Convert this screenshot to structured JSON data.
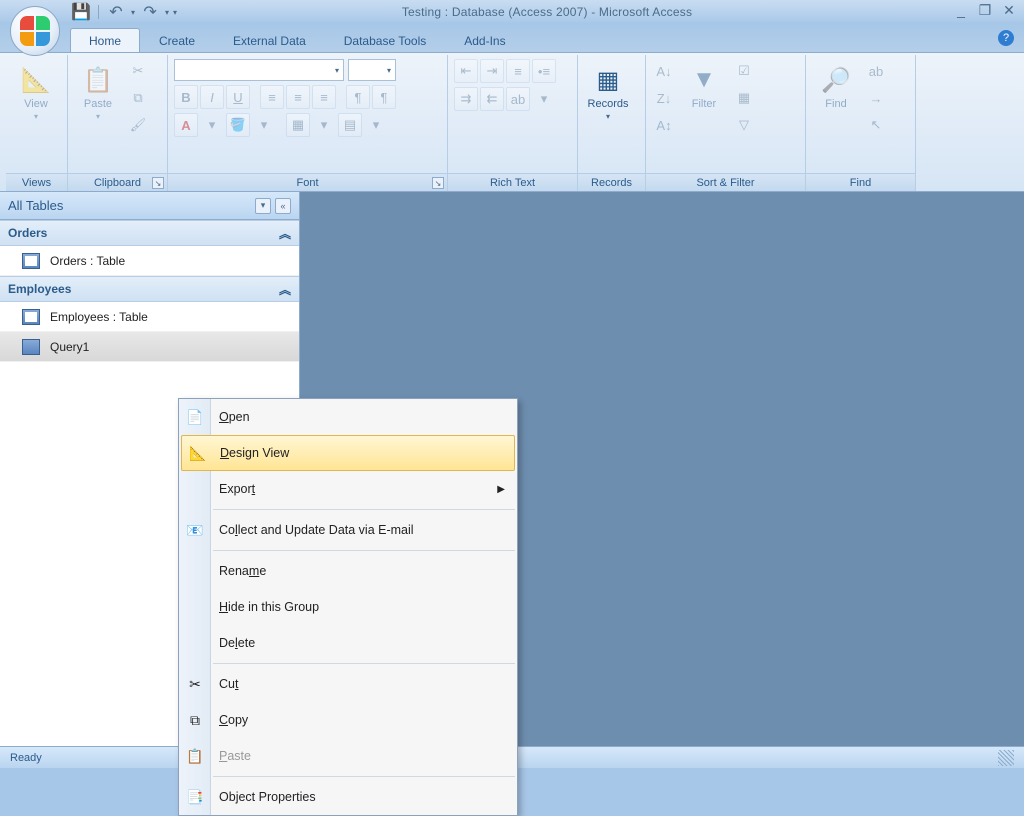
{
  "title": "Testing : Database (Access 2007) - Microsoft Access",
  "tabs": {
    "home": "Home",
    "create": "Create",
    "external": "External Data",
    "tools": "Database Tools",
    "addins": "Add-Ins"
  },
  "ribbon": {
    "views": {
      "label": "Views",
      "view": "View"
    },
    "clipboard": {
      "label": "Clipboard",
      "paste": "Paste"
    },
    "font": {
      "label": "Font",
      "bold": "B",
      "italic": "I",
      "underline": "U",
      "fontA": "A",
      "fontA2": "A"
    },
    "richtext": {
      "label": "Rich Text"
    },
    "records": {
      "label": "Records",
      "btn": "Records"
    },
    "sortfilter": {
      "label": "Sort & Filter",
      "filter": "Filter"
    },
    "find": {
      "label": "Find",
      "btn": "Find"
    }
  },
  "nav": {
    "title": "All Tables",
    "groups": [
      {
        "name": "Orders",
        "items": [
          {
            "label": "Orders : Table",
            "type": "table"
          }
        ]
      },
      {
        "name": "Employees",
        "items": [
          {
            "label": "Employees : Table",
            "type": "table"
          },
          {
            "label": "Query1",
            "type": "query",
            "selected": true
          }
        ]
      }
    ]
  },
  "context_menu": {
    "open": "Open",
    "design": "Design View",
    "export": "Export",
    "collect": "Collect and Update Data via E-mail",
    "rename": "Rename",
    "hide": "Hide in this Group",
    "delete": "Delete",
    "cut": "Cut",
    "copy": "Copy",
    "paste": "Paste",
    "props": "Object Properties"
  },
  "status": "Ready"
}
